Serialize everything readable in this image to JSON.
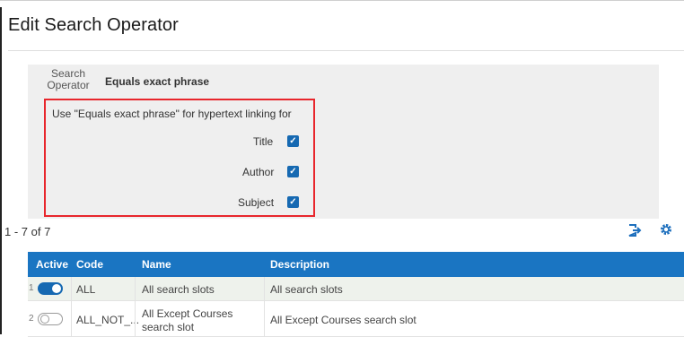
{
  "page": {
    "title": "Edit Search Operator"
  },
  "operator": {
    "label": "Search Operator",
    "value": "Equals exact phrase"
  },
  "linking": {
    "heading": "Use \"Equals exact phrase\" for hypertext linking for",
    "options": [
      {
        "label": "Title",
        "checked": true
      },
      {
        "label": "Author",
        "checked": true
      },
      {
        "label": "Subject",
        "checked": true
      }
    ]
  },
  "pager": {
    "text": "1 - 7 of 7"
  },
  "toolbar": {
    "export_icon": "export-icon",
    "settings_icon": "gear-icon"
  },
  "table": {
    "columns": [
      "Active",
      "Code",
      "Name",
      "Description"
    ],
    "rows": [
      {
        "index": "1",
        "active": true,
        "code": "ALL",
        "name": "All search slots",
        "description": "All search slots"
      },
      {
        "index": "2",
        "active": false,
        "code": "ALL_NOT_...",
        "name": "All Except Courses search slot",
        "description": "All Except Courses search slot"
      }
    ]
  },
  "colors": {
    "accent": "#1a75c2",
    "highlight": "#e8262c",
    "panel": "#efefef"
  }
}
